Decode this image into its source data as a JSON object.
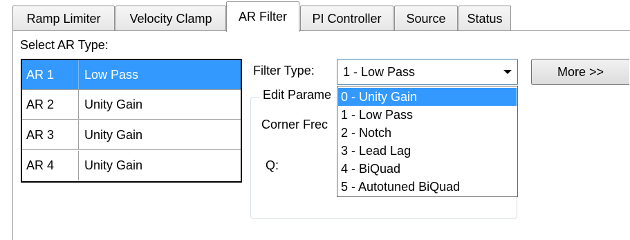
{
  "tabs": [
    {
      "label": "Ramp Limiter",
      "active": false
    },
    {
      "label": "Velocity Clamp",
      "active": false
    },
    {
      "label": "AR Filter",
      "active": true
    },
    {
      "label": "PI Controller",
      "active": false
    },
    {
      "label": "Source",
      "active": false
    },
    {
      "label": "Status",
      "active": false
    }
  ],
  "ar_panel": {
    "label": "Select AR Type:",
    "rows": [
      {
        "name": "AR 1",
        "type": "Low Pass",
        "selected": true
      },
      {
        "name": "AR 2",
        "type": "Unity Gain",
        "selected": false
      },
      {
        "name": "AR 3",
        "type": "Unity Gain",
        "selected": false
      },
      {
        "name": "AR 4",
        "type": "Unity Gain",
        "selected": false
      }
    ]
  },
  "filter": {
    "label": "Filter Type:",
    "selected_value": "1 - Low Pass",
    "more_button": "More >>",
    "options": [
      "0 - Unity Gain",
      "1 - Low Pass",
      "2 - Notch",
      "3 - Lead Lag",
      "4 - BiQuad",
      "5 - Autotuned BiQuad"
    ],
    "highlighted_index": 0
  },
  "edit_params": {
    "title": "Edit Parame",
    "corner_label": "Corner Frec",
    "q_label": "Q:"
  },
  "colors": {
    "selection": "#3399ff",
    "combo_border": "#3d7bad",
    "tab_border": "#8e8f8f"
  }
}
